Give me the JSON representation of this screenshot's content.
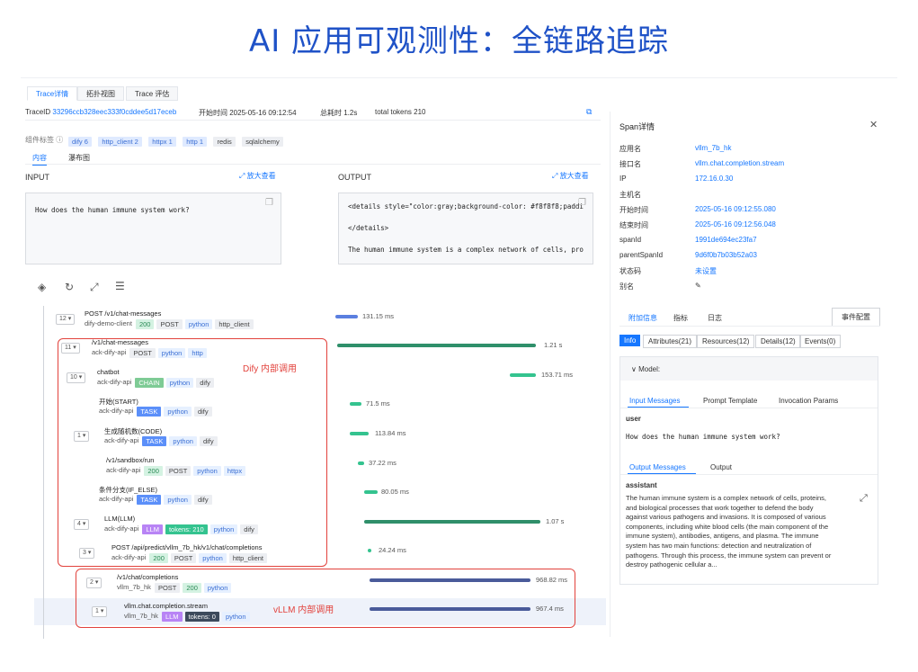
{
  "title": "AI 应用可观测性：全链路追踪",
  "tabs": [
    "Trace详情",
    "拓扑视图",
    "Trace 评估"
  ],
  "meta": {
    "traceid_label": "TraceID",
    "traceid": "33296ccb328eec333f0cddee5d17eceb",
    "start_label": "开始时间",
    "start": "2025-05-16 09:12:54",
    "total_label": "总耗时",
    "total": "1.2s",
    "tokens": "total tokens 210"
  },
  "component_label": "组件标签",
  "components": [
    "dify 6",
    "http_client 2",
    "httpx 1",
    "http 1",
    "redis",
    "sqlalchemy"
  ],
  "subtabs": [
    "内容",
    "瀑布图"
  ],
  "input_label": "INPUT",
  "output_label": "OUTPUT",
  "zoom_label": "放大查看",
  "input_text": "How does the human immune system work?",
  "output_lines": [
    "<details style=\"color:gray;background-color: #f8f8f8;paddi",
    "</details>",
    "The human immune system is a complex network of cells, pro"
  ],
  "spans": [
    {
      "count": "12",
      "name": "POST /v1/chat-messages",
      "svc": "dify-demo-client",
      "tags": [
        "200",
        "POST",
        "python",
        "http_client"
      ],
      "dur": "131.15 ms"
    },
    {
      "count": "11",
      "name": "/v1/chat-messages",
      "svc": "ack-dify-api",
      "tags": [
        "POST",
        "python",
        "http"
      ],
      "dur": "1.21 s"
    },
    {
      "count": "10",
      "name": "chatbot",
      "svc": "ack-dify-api",
      "tags": [
        "CHAIN",
        "python",
        "dify"
      ],
      "dur": "153.71 ms"
    },
    {
      "count": "",
      "name": "开始(START)",
      "svc": "ack-dify-api",
      "tags": [
        "TASK",
        "python",
        "dify"
      ],
      "dur": "71.5 ms"
    },
    {
      "count": "1",
      "name": "生成随机数(CODE)",
      "svc": "ack-dify-api",
      "tags": [
        "TASK",
        "python",
        "dify"
      ],
      "dur": "113.84 ms"
    },
    {
      "count": "",
      "name": "/v1/sandbox/run",
      "svc": "ack-dify-api",
      "tags": [
        "200",
        "POST",
        "python",
        "httpx"
      ],
      "dur": "37.22 ms"
    },
    {
      "count": "",
      "name": "条件分支(IF_ELSE)",
      "svc": "ack-dify-api",
      "tags": [
        "TASK",
        "python",
        "dify"
      ],
      "dur": "80.05 ms"
    },
    {
      "count": "4",
      "name": "LLM(LLM)",
      "svc": "ack-dify-api",
      "tags": [
        "LLM",
        "tokens: 210",
        "python",
        "dify"
      ],
      "dur": "1.07 s"
    },
    {
      "count": "3",
      "name": "POST /api/predict/vllm_7b_hk/v1/chat/completions",
      "svc": "ack-dify-api",
      "tags": [
        "200",
        "POST",
        "python",
        "http_client"
      ],
      "dur": "24.24 ms"
    },
    {
      "count": "2",
      "name": "/v1/chat/completions",
      "svc": "vllm_7b_hk",
      "tags": [
        "POST",
        "200",
        "python"
      ],
      "dur": "968.82 ms"
    },
    {
      "count": "1",
      "name": "vllm.chat.completion.stream",
      "svc": "vllm_7b_hk",
      "tags": [
        "LLM",
        "tokens: 0",
        "python"
      ],
      "dur": "967.4 ms"
    }
  ],
  "dify_label": "Dify 内部调用",
  "vllm_label": "vLLM 内部调用",
  "panel": {
    "title": "Span详情",
    "fields": [
      [
        "应用名",
        "vllm_7b_hk"
      ],
      [
        "接口名",
        "vllm.chat.completion.stream"
      ],
      [
        "IP",
        "172.16.0.30"
      ],
      [
        "主机名",
        ""
      ],
      [
        "开始时间",
        "2025-05-16 09:12:55.080"
      ],
      [
        "结束时间",
        "2025-05-16 09:12:56.048"
      ],
      [
        "spanId",
        "1991de694ec23fa7"
      ],
      [
        "parentSpanId",
        "9d6f0b7b03b52a03"
      ],
      [
        "状态码",
        "未设置"
      ],
      [
        "别名",
        "✎"
      ]
    ],
    "tabs": [
      "附加信息",
      "指标",
      "日志"
    ],
    "event_btn": "事件配置",
    "info_tabs": [
      "Info",
      "Attributes(21)",
      "Resources(12)",
      "Details(12)",
      "Events(0)"
    ],
    "model_label": "Model:",
    "msg_tabs": [
      "Input Messages",
      "Prompt Template",
      "Invocation Params"
    ],
    "user_role": "user",
    "user_msg": "How does the human immune system work?",
    "out_tabs": [
      "Output Messages",
      "Output"
    ],
    "assistant_role": "assistant",
    "assistant_lines": [
      "The human immune system is a complex network of cells, proteins,",
      "and biological processes that work together to defend the body",
      "against various pathogens and invasions. It is composed of various",
      "components, including white blood cells (the main component of the",
      "immune system), antibodies, antigens, and plasma. The immune",
      "system has two main functions: detection and neutralization of",
      "pathogens. Through this process, the immune system can prevent or",
      "destroy pathogenic cellular a..."
    ]
  },
  "colors": {
    "accent": "#1677ff",
    "title": "#1f52c7",
    "red": "#e2423c",
    "bar_green": "#34c38f",
    "bar_dark": "#2f8f6a",
    "bar_blue": "#5b7fe0",
    "bar_navy": "#4a5b9a"
  }
}
